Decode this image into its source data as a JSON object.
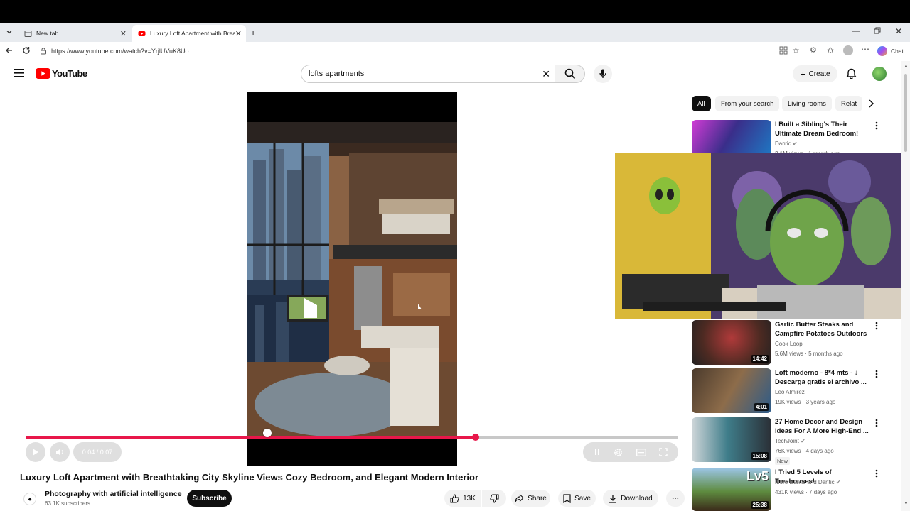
{
  "browser": {
    "tabs": [
      {
        "title": "New tab"
      },
      {
        "title": "Luxury Loft Apartment with Breathtaking City Skyline Views"
      }
    ],
    "url": "https://www.youtube.com/watch?v=YrjlUVuK8Uo",
    "chat_label": "Chat"
  },
  "header": {
    "logo_text": "YouTube",
    "search_value": "lofts apartments",
    "create_label": "Create"
  },
  "player": {
    "time": "0:04 / 0:07",
    "progress_fraction": 0.69,
    "buffer_marker_fraction": 0.37
  },
  "video": {
    "title": "Luxury Loft Apartment with Breathtaking City Skyline Views Cozy Bedroom, and Elegant Modern Interior",
    "channel": "Photography with artificial intelligence",
    "subscribers": "63.1K subscribers",
    "subscribe_label": "Subscribe",
    "likes": "13K",
    "share_label": "Share",
    "save_label": "Save",
    "download_label": "Download"
  },
  "chips": [
    "All",
    "From your search",
    "Living rooms",
    "Relat"
  ],
  "recommendations": [
    {
      "title": "I Built a Sibling's Their Ultimate Dream Bedroom!",
      "channel": "Dantic",
      "meta": "2.1M views · 1 month ago",
      "duration": "",
      "badge": ""
    },
    {
      "title": "Garlic Butter Steaks and Campfire Potatoes Outdoors",
      "channel": "Cook Loop",
      "meta": "5.6M views · 5 months ago",
      "duration": "14:42",
      "badge": ""
    },
    {
      "title": "Loft moderno - 8*4 mts - ↓ Descarga gratis el archivo ...",
      "channel": "Leo Almirez",
      "meta": "19K views · 3 years ago",
      "duration": "4:01",
      "badge": ""
    },
    {
      "title": "27 Home Decor and Design Ideas For A More High-End ...",
      "channel": "TechJoint",
      "meta": "76K views · 4 days ago",
      "duration": "15:08",
      "badge": "New"
    },
    {
      "title": "I Tried 5 Levels of Treehouses!",
      "channel": "More Dantic and Dantic",
      "meta": "431K views · 7 days ago",
      "duration": "25:38",
      "badge": ""
    }
  ],
  "colors": {
    "accent_red": "#e8174a",
    "yt_red": "#ff0000"
  }
}
